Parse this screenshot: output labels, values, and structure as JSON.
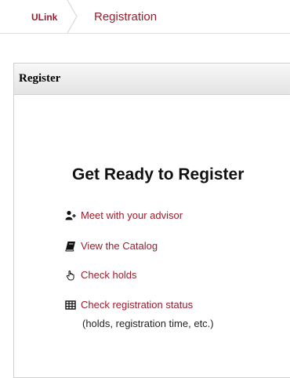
{
  "breadcrumb": {
    "home_label": "ULink",
    "current_label": "Registration"
  },
  "panel": {
    "title": "Register",
    "heading": "Get Ready to Register",
    "links": [
      {
        "label": "Meet with your advisor",
        "icon": "add-user-icon"
      },
      {
        "label": "View the Catalog",
        "icon": "book-icon"
      },
      {
        "label": "Check holds",
        "icon": "hand-icon"
      },
      {
        "label": "Check registration status",
        "icon": "table-icon"
      }
    ],
    "status_note": "(holds, registration time, etc.)"
  },
  "colors": {
    "accent": "#9b1c2c",
    "heading": "#111111"
  }
}
